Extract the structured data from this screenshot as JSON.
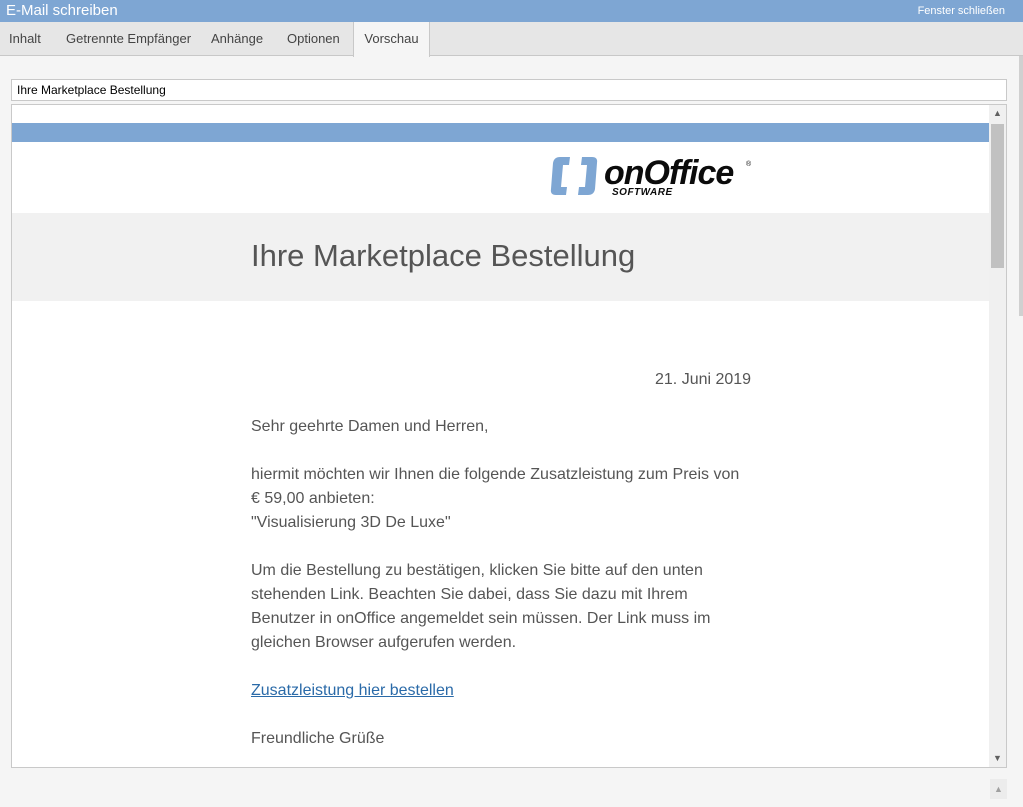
{
  "window": {
    "title": "E-Mail schreiben",
    "close_label": "Fenster schließen"
  },
  "tabs": [
    {
      "label": "Inhalt",
      "active": false
    },
    {
      "label": "Getrennte Empfänger",
      "active": false
    },
    {
      "label": "Anhänge",
      "active": false
    },
    {
      "label": "Optionen",
      "active": false
    },
    {
      "label": "Vorschau",
      "active": true
    }
  ],
  "subject": {
    "value": "Ihre Marketplace Bestellung"
  },
  "preview": {
    "logo": {
      "word": "onOffice",
      "sub": "SOFTWARE",
      "reg": "®"
    },
    "heading": "Ihre Marketplace Bestellung",
    "date": "21. Juni 2019",
    "salutation": "Sehr geehrte Damen und Herren,",
    "paragraph1": [
      "hiermit möchten wir Ihnen die folgende Zusatzleistung zum Preis von",
      "€ 59,00 anbieten:",
      "\"Visualisierung 3D De Luxe\""
    ],
    "paragraph2": [
      "Um die Bestellung zu bestätigen, klicken Sie bitte auf den unten",
      "stehenden Link. Beachten Sie dabei, dass Sie dazu mit Ihrem",
      "Benutzer in onOffice angemeldet sein müssen. Der Link muss im",
      "gleichen Browser aufgerufen werden."
    ],
    "order_link": "Zusatzleistung hier bestellen",
    "closing": "Freundliche Grüße"
  },
  "colors": {
    "accent_blue": "#7ea6d3",
    "logo_bracket": "#7ea6d3",
    "link": "#2a6aa8"
  },
  "icons": {
    "scroll_up": "chevron-up-icon",
    "scroll_down": "chevron-down-icon"
  }
}
